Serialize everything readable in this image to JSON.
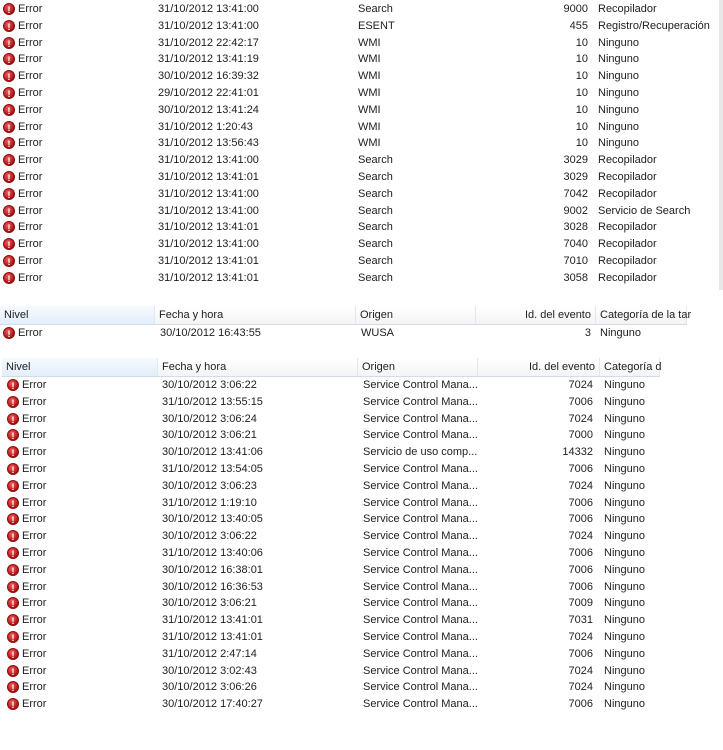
{
  "columns_a": [
    "Nivel",
    "Fecha y hora",
    "Origen",
    "Id. del evento",
    "Categoría de la tar"
  ],
  "columns_b": [
    "Nivel",
    "Fecha y hora",
    "Origen",
    "Id. del evento",
    "Categoría d"
  ],
  "icon": "error-icon",
  "table1": [
    [
      "Error",
      "31/10/2012 13:41:00",
      "Search",
      "9000",
      "Recopilador"
    ],
    [
      "Error",
      "31/10/2012 13:41:00",
      "ESENT",
      "455",
      "Registro/Recuperación"
    ],
    [
      "Error",
      "31/10/2012 22:42:17",
      "WMI",
      "10",
      "Ninguno"
    ],
    [
      "Error",
      "31/10/2012 13:41:19",
      "WMI",
      "10",
      "Ninguno"
    ],
    [
      "Error",
      "30/10/2012 16:39:32",
      "WMI",
      "10",
      "Ninguno"
    ],
    [
      "Error",
      "29/10/2012 22:41:01",
      "WMI",
      "10",
      "Ninguno"
    ],
    [
      "Error",
      "30/10/2012 13:41:24",
      "WMI",
      "10",
      "Ninguno"
    ],
    [
      "Error",
      "31/10/2012 1:20:43",
      "WMI",
      "10",
      "Ninguno"
    ],
    [
      "Error",
      "31/10/2012 13:56:43",
      "WMI",
      "10",
      "Ninguno"
    ],
    [
      "Error",
      "31/10/2012 13:41:00",
      "Search",
      "3029",
      "Recopilador"
    ],
    [
      "Error",
      "31/10/2012 13:41:01",
      "Search",
      "3029",
      "Recopilador"
    ],
    [
      "Error",
      "31/10/2012 13:41:00",
      "Search",
      "7042",
      "Recopilador"
    ],
    [
      "Error",
      "31/10/2012 13:41:00",
      "Search",
      "9002",
      "Servicio de Search"
    ],
    [
      "Error",
      "31/10/2012 13:41:01",
      "Search",
      "3028",
      "Recopilador"
    ],
    [
      "Error",
      "31/10/2012 13:41:00",
      "Search",
      "7040",
      "Recopilador"
    ],
    [
      "Error",
      "31/10/2012 13:41:01",
      "Search",
      "7010",
      "Recopilador"
    ],
    [
      "Error",
      "31/10/2012 13:41:01",
      "Search",
      "3058",
      "Recopilador"
    ]
  ],
  "table2": [
    [
      "Error",
      "30/10/2012 16:43:55",
      "WUSA",
      "3",
      "Ninguno"
    ]
  ],
  "table3": [
    [
      "Error",
      "30/10/2012 3:06:22",
      "Service Control Mana...",
      "7024",
      "Ninguno"
    ],
    [
      "Error",
      "31/10/2012 13:55:15",
      "Service Control Mana...",
      "7006",
      "Ninguno"
    ],
    [
      "Error",
      "30/10/2012 3:06:24",
      "Service Control Mana...",
      "7024",
      "Ninguno"
    ],
    [
      "Error",
      "30/10/2012 3:06:21",
      "Service Control Mana...",
      "7000",
      "Ninguno"
    ],
    [
      "Error",
      "30/10/2012 13:41:06",
      "Servicio de uso comp...",
      "14332",
      "Ninguno"
    ],
    [
      "Error",
      "31/10/2012 13:54:05",
      "Service Control Mana...",
      "7006",
      "Ninguno"
    ],
    [
      "Error",
      "30/10/2012 3:06:23",
      "Service Control Mana...",
      "7024",
      "Ninguno"
    ],
    [
      "Error",
      "31/10/2012 1:19:10",
      "Service Control Mana...",
      "7006",
      "Ninguno"
    ],
    [
      "Error",
      "30/10/2012 13:40:05",
      "Service Control Mana...",
      "7006",
      "Ninguno"
    ],
    [
      "Error",
      "30/10/2012 3:06:22",
      "Service Control Mana...",
      "7024",
      "Ninguno"
    ],
    [
      "Error",
      "31/10/2012 13:40:06",
      "Service Control Mana...",
      "7006",
      "Ninguno"
    ],
    [
      "Error",
      "30/10/2012 16:38:01",
      "Service Control Mana...",
      "7006",
      "Ninguno"
    ],
    [
      "Error",
      "30/10/2012 16:36:53",
      "Service Control Mana...",
      "7006",
      "Ninguno"
    ],
    [
      "Error",
      "30/10/2012 3:06:21",
      "Service Control Mana...",
      "7009",
      "Ninguno"
    ],
    [
      "Error",
      "31/10/2012 13:41:01",
      "Service Control Mana...",
      "7031",
      "Ninguno"
    ],
    [
      "Error",
      "31/10/2012 13:41:01",
      "Service Control Mana...",
      "7024",
      "Ninguno"
    ],
    [
      "Error",
      "31/10/2012 2:47:14",
      "Service Control Mana...",
      "7006",
      "Ninguno"
    ],
    [
      "Error",
      "30/10/2012 3:02:43",
      "Service Control Mana...",
      "7024",
      "Ninguno"
    ],
    [
      "Error",
      "30/10/2012 3:06:26",
      "Service Control Mana...",
      "7024",
      "Ninguno"
    ],
    [
      "Error",
      "30/10/2012 17:40:27",
      "Service Control Mana...",
      "7006",
      "Ninguno"
    ]
  ]
}
